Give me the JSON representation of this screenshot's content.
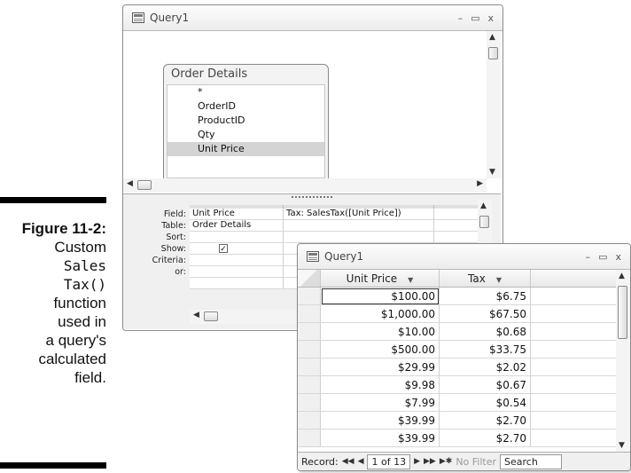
{
  "caption": {
    "figure": "Figure 11-2:",
    "lines": [
      "Custom",
      "Sales",
      "Tax()",
      "function",
      "used in",
      "a query's",
      "calculated",
      "field."
    ]
  },
  "design_window": {
    "title": "Query1",
    "controls": {
      "minimize": "–",
      "maximize": "▭",
      "close": "x"
    },
    "field_list": {
      "title": "Order Details",
      "items": [
        "*",
        "OrderID",
        "ProductID",
        "Qty",
        "Unit Price"
      ],
      "selected": "Unit Price"
    },
    "grid": {
      "row_labels": [
        "Field:",
        "Table:",
        "Sort:",
        "Show:",
        "Criteria:",
        "or:"
      ],
      "columns": [
        {
          "field": "Unit Price",
          "table": "Order Details",
          "show": true
        },
        {
          "field": "Tax: SalesTax([Unit Price])",
          "table": "",
          "show": true
        }
      ],
      "check_glyph": "✓"
    }
  },
  "datasheet_window": {
    "title": "Query1",
    "controls": {
      "minimize": "–",
      "maximize": "▭",
      "close": "x"
    },
    "columns": [
      "Unit Price",
      "Tax"
    ],
    "rows": [
      [
        "$100.00",
        "$6.75"
      ],
      [
        "$1,000.00",
        "$67.50"
      ],
      [
        "$10.00",
        "$0.68"
      ],
      [
        "$500.00",
        "$33.75"
      ],
      [
        "$29.99",
        "$2.02"
      ],
      [
        "$9.98",
        "$0.67"
      ],
      [
        "$7.99",
        "$0.54"
      ],
      [
        "$39.99",
        "$2.70"
      ],
      [
        "$39.99",
        "$2.70"
      ]
    ],
    "nav": {
      "label": "Record:",
      "first": "◀◀",
      "prev": "◀",
      "position": "1 of 13",
      "next": "▶",
      "last": "▶▶",
      "new": "▶✱",
      "filter": "No Filter",
      "search": "Search"
    }
  }
}
